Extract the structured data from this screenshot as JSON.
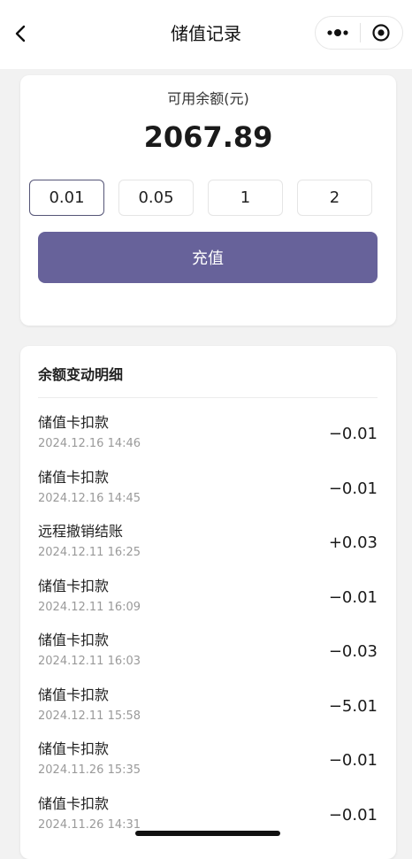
{
  "header": {
    "title": "储值记录"
  },
  "balance": {
    "label": "可用余额(元)",
    "amount": "2067.89"
  },
  "recharge_options": {
    "selected": "0.01",
    "options": [
      "0.01",
      "0.05",
      "1",
      "2"
    ]
  },
  "recharge_button": "充值",
  "detail": {
    "title": "余额变动明细",
    "items": [
      {
        "name": "储值卡扣款",
        "time": "2024.12.16 14:46",
        "amount": "−0.01"
      },
      {
        "name": "储值卡扣款",
        "time": "2024.12.16 14:45",
        "amount": "−0.01"
      },
      {
        "name": "远程撤销结账",
        "time": "2024.12.11 16:25",
        "amount": "+0.03"
      },
      {
        "name": "储值卡扣款",
        "time": "2024.12.11 16:09",
        "amount": "−0.01"
      },
      {
        "name": "储值卡扣款",
        "time": "2024.12.11 16:03",
        "amount": "−0.03"
      },
      {
        "name": "储值卡扣款",
        "time": "2024.12.11 15:58",
        "amount": "−5.01"
      },
      {
        "name": "储值卡扣款",
        "time": "2024.11.26 15:35",
        "amount": "−0.01"
      },
      {
        "name": "储值卡扣款",
        "time": "2024.11.26 14:31",
        "amount": "−0.01"
      }
    ]
  },
  "colors": {
    "accent": "#67629a",
    "background": "#f2f2f2"
  },
  "icons": [
    "back-arrow-icon",
    "more-dots-icon",
    "target-circle-icon"
  ]
}
